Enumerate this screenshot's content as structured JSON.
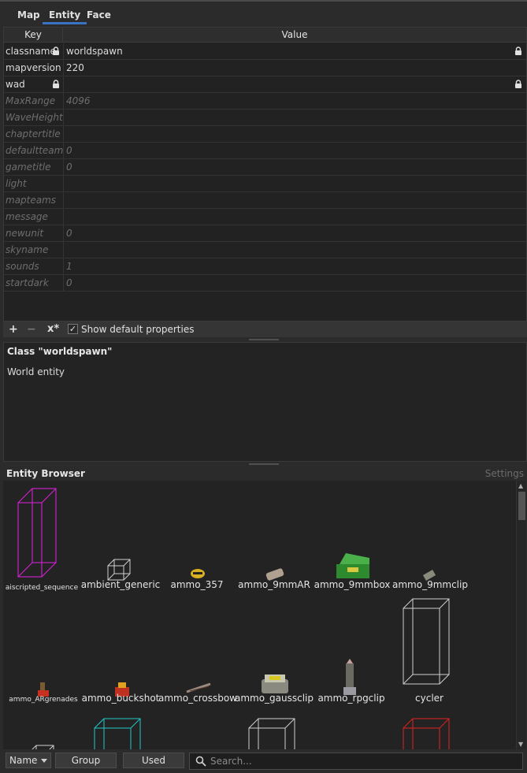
{
  "tabs": [
    {
      "label": "Map",
      "active": false
    },
    {
      "label": "Entity",
      "active": true
    },
    {
      "label": "Face",
      "active": false
    }
  ],
  "properties": {
    "header_key": "Key",
    "header_value": "Value",
    "rows": [
      {
        "key": "classname",
        "value": "worldspawn",
        "default": false,
        "key_locked": true,
        "value_locked": true
      },
      {
        "key": "mapversion",
        "value": "220",
        "default": false,
        "key_locked": false,
        "value_locked": false
      },
      {
        "key": "wad",
        "value": "",
        "default": false,
        "key_locked": true,
        "value_locked": true
      },
      {
        "key": "MaxRange",
        "value": "4096",
        "default": true
      },
      {
        "key": "WaveHeight",
        "value": "",
        "default": true
      },
      {
        "key": "chaptertitle",
        "value": "",
        "default": true
      },
      {
        "key": "defaultteam",
        "value": "0",
        "default": true
      },
      {
        "key": "gametitle",
        "value": "0",
        "default": true
      },
      {
        "key": "light",
        "value": "",
        "default": true
      },
      {
        "key": "mapteams",
        "value": "",
        "default": true
      },
      {
        "key": "message",
        "value": "",
        "default": true
      },
      {
        "key": "newunit",
        "value": "0",
        "default": true
      },
      {
        "key": "skyname",
        "value": "",
        "default": true
      },
      {
        "key": "sounds",
        "value": "1",
        "default": true
      },
      {
        "key": "startdark",
        "value": "0",
        "default": true
      }
    ]
  },
  "toolbar": {
    "add_label": "+",
    "remove_label": "−",
    "clear_label": "x*",
    "show_default_checked": true,
    "show_default_label": "Show default properties"
  },
  "class_info": {
    "title": "Class \"worldspawn\"",
    "description": "World entity"
  },
  "entity_browser": {
    "title": "Entity Browser",
    "settings_label": "Settings",
    "entities": [
      {
        "name": "aiscripted_sequence",
        "kind": "box",
        "color": "#e020e0"
      },
      {
        "name": "ambient_generic",
        "kind": "box",
        "color": "#cfcfcf"
      },
      {
        "name": "ammo_357",
        "kind": "model",
        "color": "#d8b020"
      },
      {
        "name": "ammo_9mmAR",
        "kind": "model",
        "color": "#b0a090"
      },
      {
        "name": "ammo_9mmbox",
        "kind": "model",
        "color": "#2e8a2e"
      },
      {
        "name": "ammo_9mmclip",
        "kind": "model",
        "color": "#8a8a7a"
      },
      {
        "name": "ammo_ARgrenades",
        "kind": "model",
        "color": "#7a5a30"
      },
      {
        "name": "ammo_buckshot",
        "kind": "model",
        "color": "#c03020"
      },
      {
        "name": "ammo_crossbow",
        "kind": "model",
        "color": "#9a8a80"
      },
      {
        "name": "ammo_gaussclip",
        "kind": "model",
        "color": "#c8c8b0"
      },
      {
        "name": "ammo_rpgclip",
        "kind": "model",
        "color": "#6a6a60"
      },
      {
        "name": "cycler",
        "kind": "box",
        "color": "#cfcfcf"
      },
      {
        "name": "",
        "kind": "box",
        "color": "#cfcfcf"
      },
      {
        "name": "",
        "kind": "box",
        "color": "#20c8c8"
      },
      {
        "name": "",
        "kind": "box",
        "color": "#cfcfcf"
      },
      {
        "name": "",
        "kind": "box",
        "color": "#e02020"
      }
    ]
  },
  "bottom_bar": {
    "sort_value": "Name",
    "group_label": "Group",
    "used_label": "Used",
    "search_placeholder": "Search..."
  },
  "colors": {
    "accent": "#3a72c4",
    "panel_bg": "#222222",
    "window_bg": "#2b2b2b"
  }
}
